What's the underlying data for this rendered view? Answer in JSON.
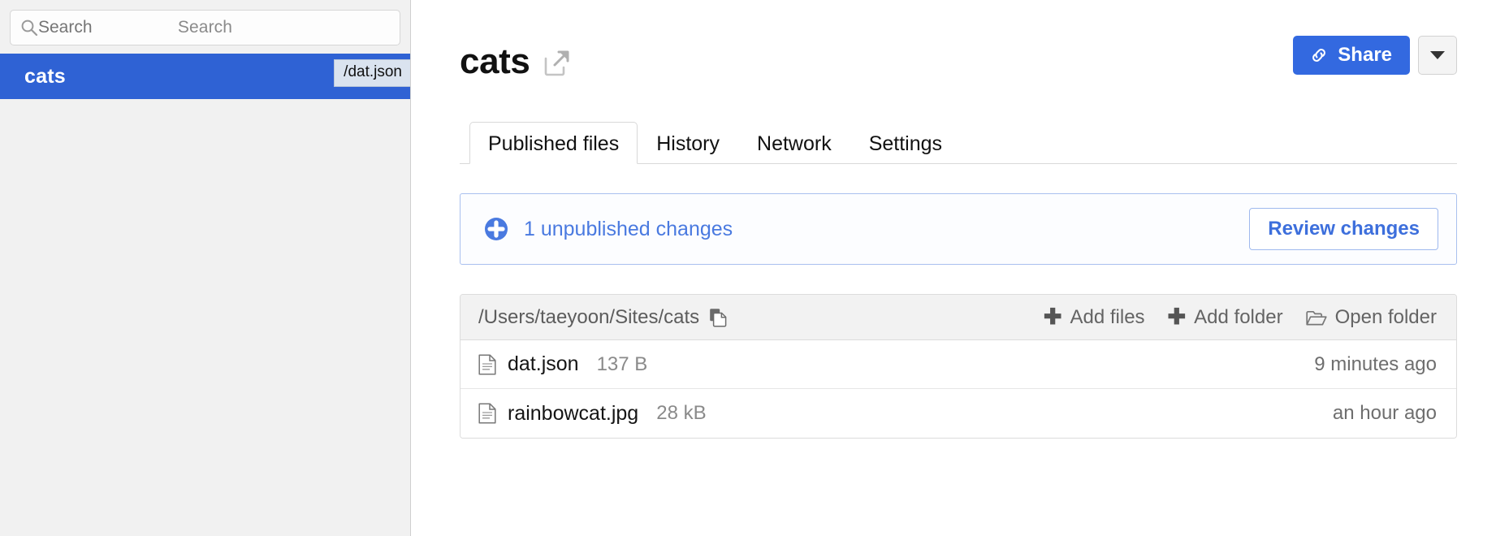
{
  "sidebar": {
    "search": {
      "placeholder": "Search",
      "value": "",
      "icon": "search-icon"
    },
    "sites": [
      {
        "name": "cats",
        "badge": "/dat.json",
        "selected": true
      }
    ]
  },
  "header": {
    "title": "cats",
    "external_link_icon": "external-link-icon",
    "share_label": "Share",
    "share_icon": "link-icon",
    "dropdown_icon": "chevron-down-icon",
    "accent_color": "#3369e0"
  },
  "tabs": [
    {
      "label": "Published files",
      "active": true
    },
    {
      "label": "History",
      "active": false
    },
    {
      "label": "Network",
      "active": false
    },
    {
      "label": "Settings",
      "active": false
    }
  ],
  "banner": {
    "icon": "plus-circle-icon",
    "message": "1 unpublished changes",
    "action_label": "Review changes",
    "color": "#4a7ae0"
  },
  "files_panel": {
    "path": "/Users/taeyoon/Sites/cats",
    "copy_icon": "copy-icon",
    "actions": [
      {
        "label": "Add files",
        "icon": "plus-icon"
      },
      {
        "label": "Add folder",
        "icon": "plus-icon"
      },
      {
        "label": "Open folder",
        "icon": "folder-open-icon"
      }
    ],
    "files": [
      {
        "icon": "file-icon",
        "name": "dat.json",
        "size": "137 B",
        "modified": "9 minutes ago"
      },
      {
        "icon": "file-icon",
        "name": "rainbowcat.jpg",
        "size": "28 kB",
        "modified": "an hour ago"
      }
    ]
  }
}
